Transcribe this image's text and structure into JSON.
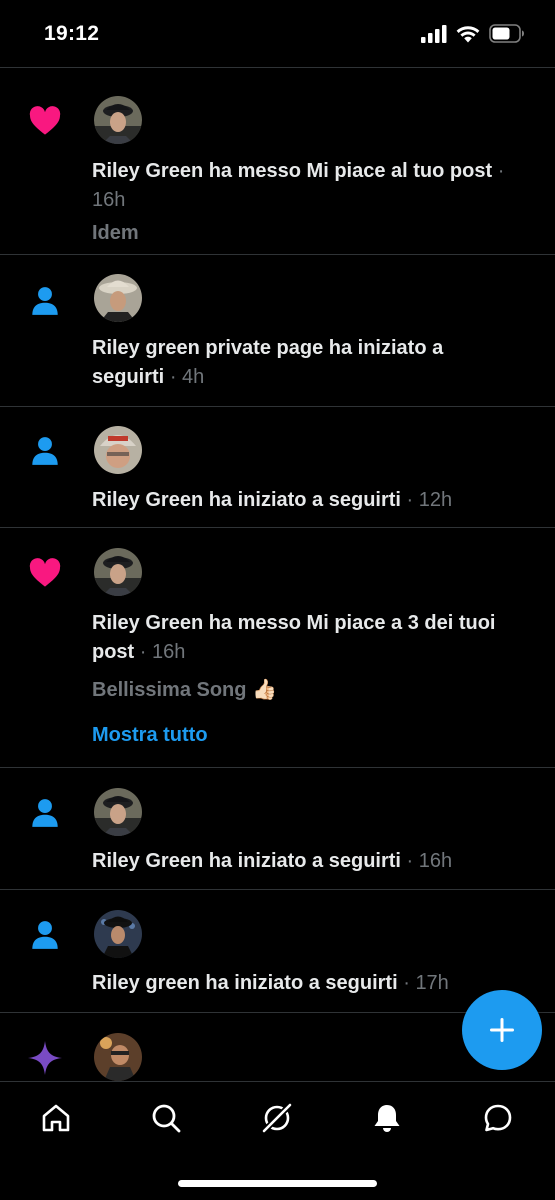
{
  "status_bar": {
    "time": "19:12"
  },
  "notifications": [
    {
      "kind": "like",
      "icon": "heart-icon",
      "text": "Riley Green ha messo Mi piace al tuo post",
      "time": "16h",
      "quote": "Idem"
    },
    {
      "kind": "follow",
      "icon": "person-icon",
      "text": "Riley green private page ha iniziato a seguirti",
      "time": "4h"
    },
    {
      "kind": "follow",
      "icon": "person-icon",
      "text": "Riley Green ha iniziato a seguirti",
      "time": "12h"
    },
    {
      "kind": "like",
      "icon": "heart-icon",
      "text": "Riley Green ha messo Mi piace a 3 dei tuoi post",
      "time": "16h",
      "quote": "Bellissima Song 👍🏻",
      "show_all": "Mostra tutto"
    },
    {
      "kind": "follow",
      "icon": "person-icon",
      "text": "Riley Green ha iniziato a seguirti",
      "time": "16h"
    },
    {
      "kind": "follow",
      "icon": "person-icon",
      "text": "Riley green ha iniziato a seguirti",
      "time": "17h"
    },
    {
      "kind": "recommendation",
      "icon": "sparkle-icon"
    }
  ],
  "separator": "·",
  "fab": {
    "icon": "plus-icon"
  },
  "tab_bar": [
    {
      "icon": "home-icon"
    },
    {
      "icon": "search-icon"
    },
    {
      "icon": "grok-icon"
    },
    {
      "icon": "bell-icon",
      "active": true
    },
    {
      "icon": "messages-icon"
    }
  ],
  "colors": {
    "background": "#000000",
    "accent": "#1d9bf0",
    "like": "#f91880",
    "sparkle": "#794bc4",
    "secondary_text": "#71767b",
    "divider": "#2f3336"
  }
}
